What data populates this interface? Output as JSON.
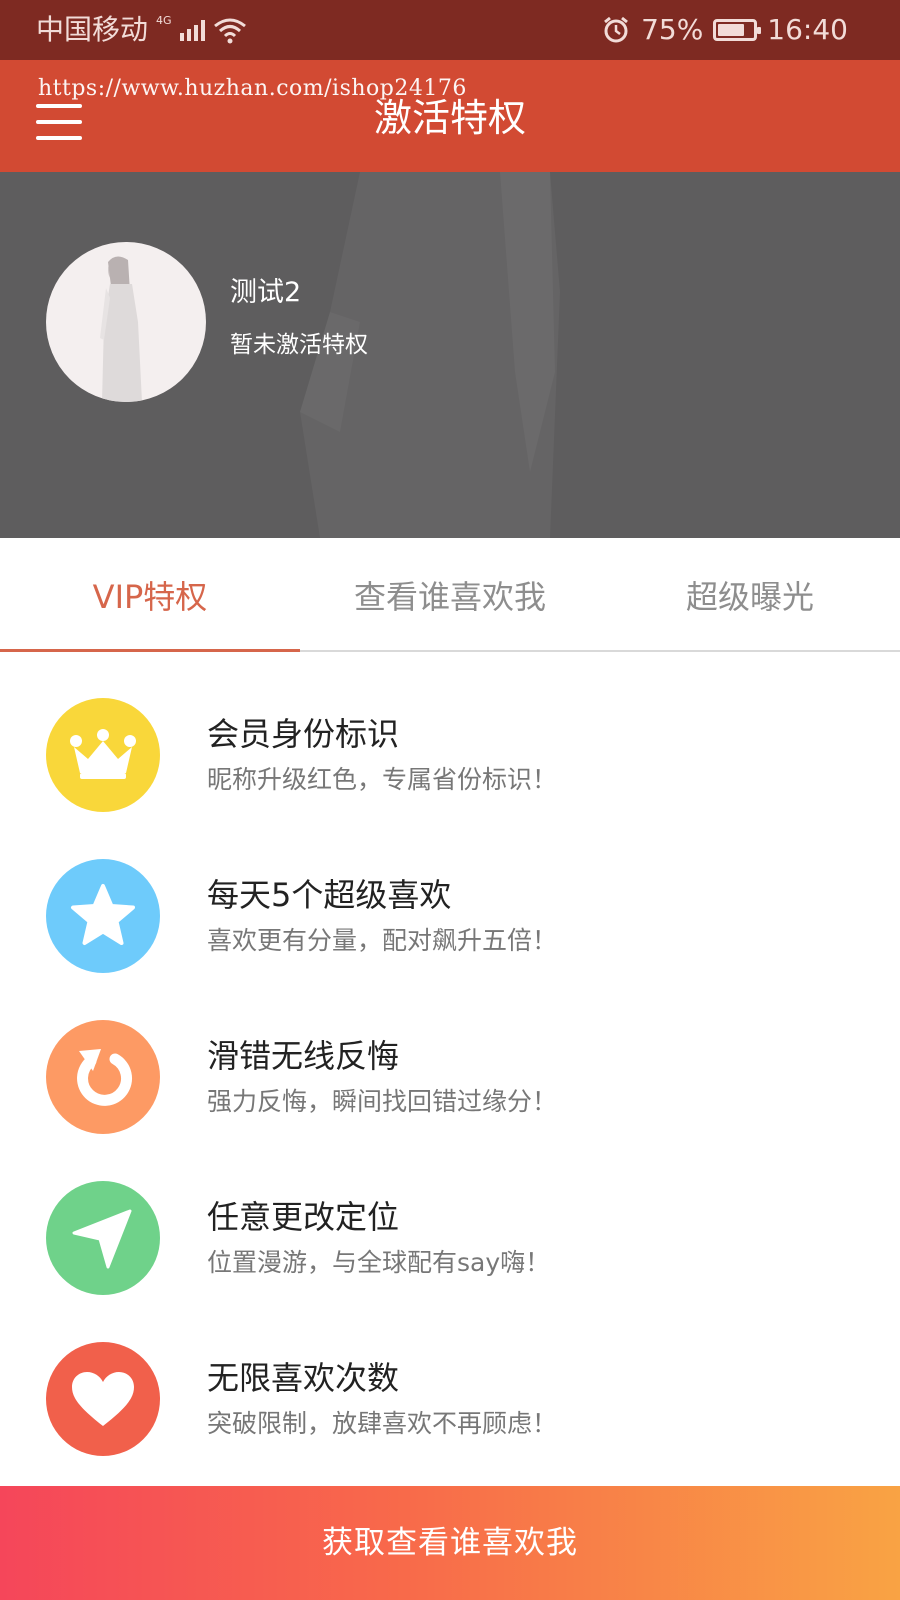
{
  "status_bar": {
    "carrier": "中国移动",
    "network": "4G",
    "battery_percent": "75%",
    "battery_level": 0.75,
    "time": "16:40"
  },
  "header": {
    "title": "激活特权",
    "watermark": "https://www.huzhan.com/ishop24176"
  },
  "profile": {
    "username": "测试2",
    "status": "暂未激活特权"
  },
  "tabs": [
    {
      "label": "VIP特权",
      "active": true
    },
    {
      "label": "查看谁喜欢我",
      "active": false
    },
    {
      "label": "超级曝光",
      "active": false
    }
  ],
  "features": [
    {
      "icon": "crown-icon",
      "color": "#f9d73a",
      "title": "会员身份标识",
      "desc": "昵称升级红色，专属省份标识！"
    },
    {
      "icon": "star-icon",
      "color": "#6ecbfb",
      "title": "每天5个超级喜欢",
      "desc": "喜欢更有分量，配对飙升五倍！"
    },
    {
      "icon": "undo-icon",
      "color": "#fd9a64",
      "title": "滑错无线反悔",
      "desc": "强力反悔，瞬间找回错过缘分！"
    },
    {
      "icon": "location-arrow-icon",
      "color": "#6fd28a",
      "title": "任意更改定位",
      "desc": "位置漫游，与全球配有say嗨！"
    },
    {
      "icon": "heart-icon",
      "color": "#f1604b",
      "title": "无限喜欢次数",
      "desc": "突破限制，放肆喜欢不再顾虑！"
    }
  ],
  "cta": {
    "label": "获取查看谁喜欢我"
  },
  "colors": {
    "status_bar": "#7e2a22",
    "header": "#d24a33",
    "accent": "#d6664b",
    "banner": "#5e5d5e"
  }
}
